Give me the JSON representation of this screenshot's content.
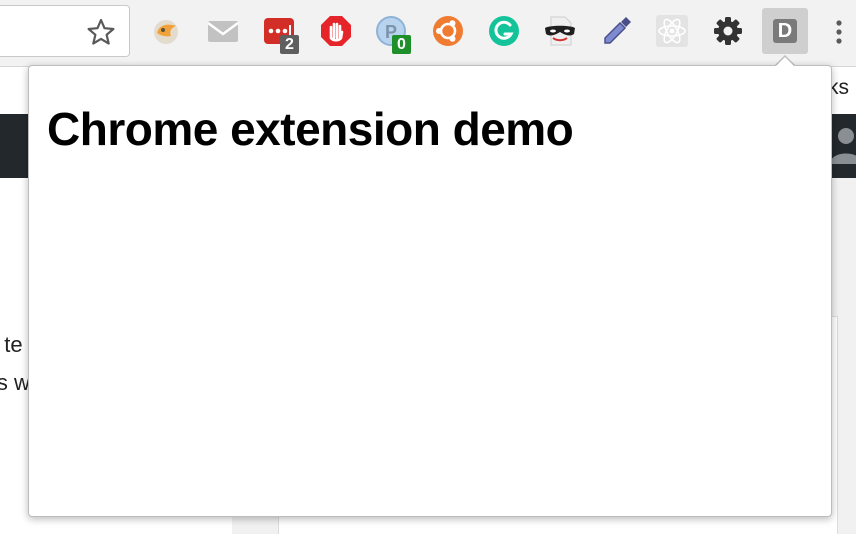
{
  "toolbar": {
    "extensions": [
      {
        "name": "honey-extension",
        "icon": "fox-icon"
      },
      {
        "name": "gmail-checker-extension",
        "icon": "mail-icon"
      },
      {
        "name": "lastpass-extension",
        "icon": "lastpass-icon",
        "badge": "2"
      },
      {
        "name": "adblock-extension",
        "icon": "hand-stop-icon"
      },
      {
        "name": "pinterest-extension",
        "icon": "pinterest-icon",
        "badge": "0"
      },
      {
        "name": "ubuntu-extension",
        "icon": "ubuntu-icon"
      },
      {
        "name": "grammarly-extension",
        "icon": "grammarly-icon"
      },
      {
        "name": "incognito-extension",
        "icon": "mask-icon"
      },
      {
        "name": "colorpicker-extension",
        "icon": "eyedropper-icon"
      },
      {
        "name": "react-devtools-extension",
        "icon": "react-icon"
      },
      {
        "name": "settings-extension",
        "icon": "gear-icon"
      },
      {
        "name": "demo-extension",
        "icon": "d-icon",
        "label": "D"
      }
    ],
    "colors": {
      "lastpass": "#d32d27",
      "adblock": "#e5252a",
      "ubuntu": "#f07c32",
      "grammarly": "#15c39a",
      "badge_gray": "#5f5f5f",
      "badge_green": "#1f8f2a"
    }
  },
  "page": {
    "bookmarks_fragment": "ks",
    "body_line_1": "t te",
    "body_line_2": "is w"
  },
  "popup": {
    "title": "Chrome extension demo"
  }
}
